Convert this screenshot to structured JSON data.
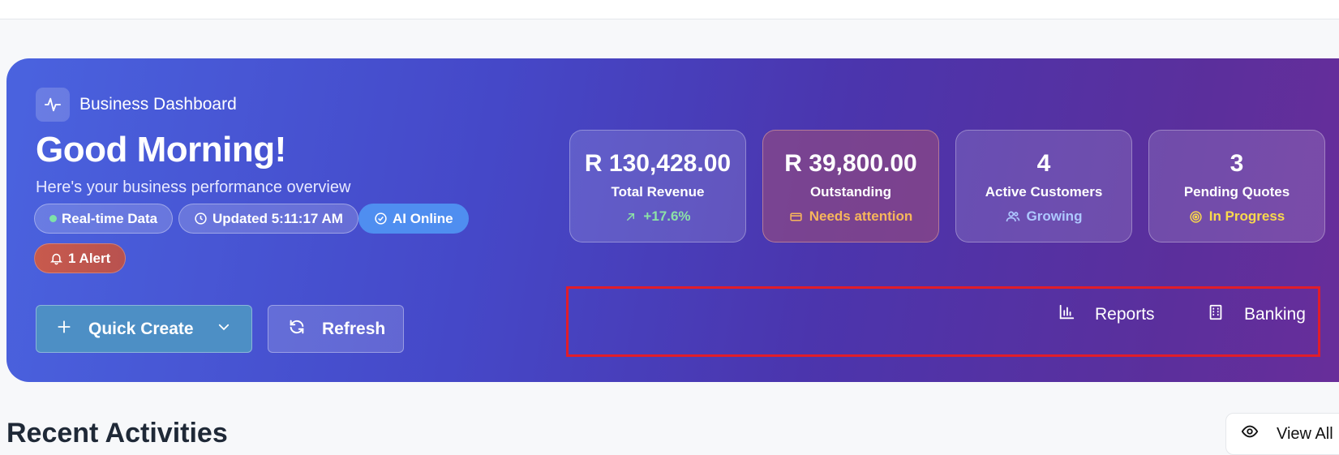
{
  "hero": {
    "brand_label": "Business Dashboard",
    "greeting": "Good Morning!",
    "subtitle": "Here's your business performance overview",
    "pills": {
      "realtime": "Real-time Data",
      "updated": "Updated 5:11:17 AM",
      "ai": "AI Online",
      "alert": "1 Alert"
    },
    "buttons": {
      "quick_create": "Quick Create",
      "refresh": "Refresh"
    },
    "stats": [
      {
        "value": "R 130,428.00",
        "label": "Total Revenue",
        "sub": "+17.6%",
        "sub_icon": "trend-up-icon"
      },
      {
        "value": "R 39,800.00",
        "label": "Outstanding",
        "sub": "Needs attention",
        "sub_icon": "card-icon"
      },
      {
        "value": "4",
        "label": "Active Customers",
        "sub": "Growing",
        "sub_icon": "users-icon"
      },
      {
        "value": "3",
        "label": "Pending Quotes",
        "sub": "In Progress",
        "sub_icon": "target-icon"
      }
    ],
    "links": {
      "reports": "Reports",
      "banking": "Banking"
    }
  },
  "section": {
    "title": "Recent Activities",
    "view_all": "View All"
  },
  "colors": {
    "hero_start": "#4a63df",
    "hero_end": "#6a2e9a",
    "highlight": "#e11d2a",
    "positive": "#8ce2a6",
    "warning": "#f7b65b"
  }
}
